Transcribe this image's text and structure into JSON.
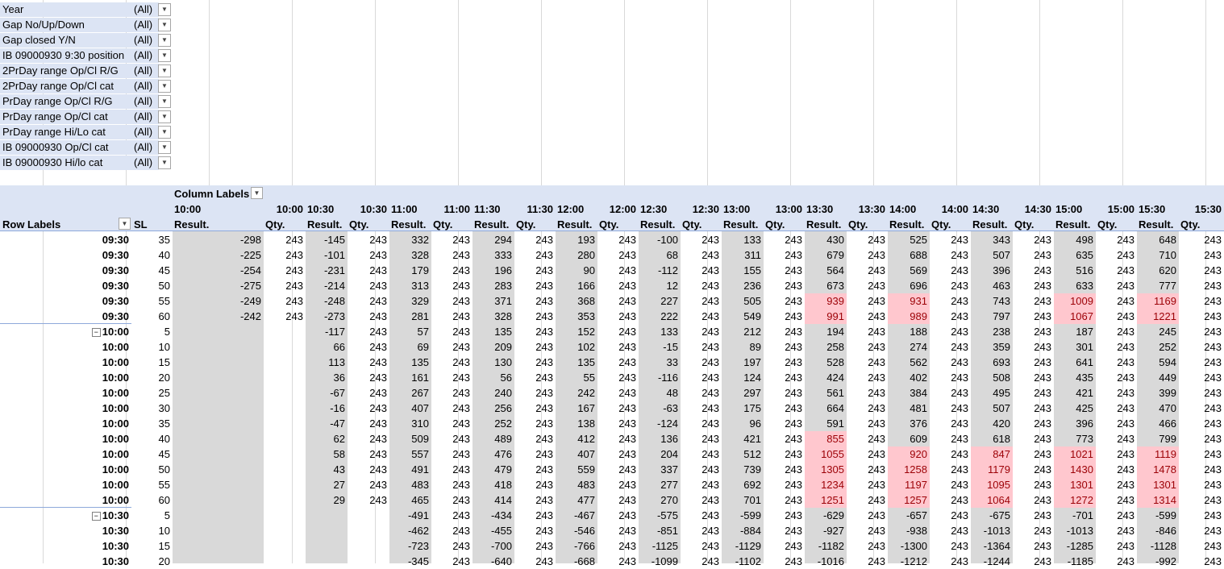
{
  "filters": [
    {
      "label": "Year",
      "value": "(All)"
    },
    {
      "label": "Gap No/Up/Down",
      "value": "(All)"
    },
    {
      "label": "Gap closed Y/N",
      "value": "(All)"
    },
    {
      "label": "IB 09000930 9:30 position",
      "value": "(All)"
    },
    {
      "label": "2PrDay range Op/Cl R/G",
      "value": "(All)"
    },
    {
      "label": "2PrDay range Op/Cl cat",
      "value": "(All)"
    },
    {
      "label": "PrDay range Op/Cl R/G",
      "value": "(All)"
    },
    {
      "label": "PrDay range Op/Cl cat",
      "value": "(All)"
    },
    {
      "label": "PrDay range Hi/Lo cat",
      "value": "(All)"
    },
    {
      "label": "IB 09000930 Op/Cl cat",
      "value": "(All)"
    },
    {
      "label": "IB 09000930 Hi/lo cat",
      "value": "(All)"
    }
  ],
  "pivot": {
    "column_labels_title": "Column Labels",
    "row_labels_title": "Row Labels",
    "sl_title": "SL",
    "column_headers": [
      {
        "time": "10:00",
        "measure": "Result."
      },
      {
        "time": "10:00",
        "measure": "Qty."
      },
      {
        "time": "10:30",
        "measure": "Result."
      },
      {
        "time": "10:30",
        "measure": "Qty."
      },
      {
        "time": "11:00",
        "measure": "Result."
      },
      {
        "time": "11:00",
        "measure": "Qty."
      },
      {
        "time": "11:30",
        "measure": "Result."
      },
      {
        "time": "11:30",
        "measure": "Qty."
      },
      {
        "time": "12:00",
        "measure": "Result."
      },
      {
        "time": "12:00",
        "measure": "Qty."
      },
      {
        "time": "12:30",
        "measure": "Result."
      },
      {
        "time": "12:30",
        "measure": "Qty."
      },
      {
        "time": "13:00",
        "measure": "Result."
      },
      {
        "time": "13:00",
        "measure": "Qty."
      },
      {
        "time": "13:30",
        "measure": "Result."
      },
      {
        "time": "13:30",
        "measure": "Qty."
      },
      {
        "time": "14:00",
        "measure": "Result."
      },
      {
        "time": "14:00",
        "measure": "Qty."
      },
      {
        "time": "14:30",
        "measure": "Result."
      },
      {
        "time": "14:30",
        "measure": "Qty."
      },
      {
        "time": "15:00",
        "measure": "Result."
      },
      {
        "time": "15:00",
        "measure": "Qty."
      },
      {
        "time": "15:30",
        "measure": "Result."
      },
      {
        "time": "15:30",
        "measure": "Qty."
      }
    ],
    "rows": [
      {
        "label": "09:30",
        "group": false,
        "sl": "35",
        "cells": [
          "-298",
          "243",
          "-145",
          "243",
          "332",
          "243",
          "294",
          "243",
          "193",
          "243",
          "-100",
          "243",
          "133",
          "243",
          "430",
          "243",
          "525",
          "243",
          "343",
          "243",
          "498",
          "243",
          "648",
          "243"
        ],
        "hl": []
      },
      {
        "label": "09:30",
        "group": false,
        "sl": "40",
        "cells": [
          "-225",
          "243",
          "-101",
          "243",
          "328",
          "243",
          "333",
          "243",
          "280",
          "243",
          "68",
          "243",
          "311",
          "243",
          "679",
          "243",
          "688",
          "243",
          "507",
          "243",
          "635",
          "243",
          "710",
          "243"
        ],
        "hl": []
      },
      {
        "label": "09:30",
        "group": false,
        "sl": "45",
        "cells": [
          "-254",
          "243",
          "-231",
          "243",
          "179",
          "243",
          "196",
          "243",
          "90",
          "243",
          "-112",
          "243",
          "155",
          "243",
          "564",
          "243",
          "569",
          "243",
          "396",
          "243",
          "516",
          "243",
          "620",
          "243"
        ],
        "hl": []
      },
      {
        "label": "09:30",
        "group": false,
        "sl": "50",
        "cells": [
          "-275",
          "243",
          "-214",
          "243",
          "313",
          "243",
          "283",
          "243",
          "166",
          "243",
          "12",
          "243",
          "236",
          "243",
          "673",
          "243",
          "696",
          "243",
          "463",
          "243",
          "633",
          "243",
          "777",
          "243"
        ],
        "hl": []
      },
      {
        "label": "09:30",
        "group": false,
        "sl": "55",
        "cells": [
          "-249",
          "243",
          "-248",
          "243",
          "329",
          "243",
          "371",
          "243",
          "368",
          "243",
          "227",
          "243",
          "505",
          "243",
          "939",
          "243",
          "931",
          "243",
          "743",
          "243",
          "1009",
          "243",
          "1169",
          "243"
        ],
        "hl": [
          14,
          16,
          20,
          22
        ]
      },
      {
        "label": "09:30",
        "group": false,
        "sl": "60",
        "cells": [
          "-242",
          "243",
          "-273",
          "243",
          "281",
          "243",
          "328",
          "243",
          "353",
          "243",
          "222",
          "243",
          "549",
          "243",
          "991",
          "243",
          "989",
          "243",
          "797",
          "243",
          "1067",
          "243",
          "1221",
          "243"
        ],
        "hl": [
          14,
          16,
          20,
          22
        ]
      },
      {
        "label": "10:00",
        "group": true,
        "sl": "5",
        "cells": [
          "",
          "",
          "-117",
          "243",
          "57",
          "243",
          "135",
          "243",
          "152",
          "243",
          "133",
          "243",
          "212",
          "243",
          "194",
          "243",
          "188",
          "243",
          "238",
          "243",
          "187",
          "243",
          "245",
          "243"
        ],
        "hl": []
      },
      {
        "label": "10:00",
        "group": false,
        "sl": "10",
        "cells": [
          "",
          "",
          "66",
          "243",
          "69",
          "243",
          "209",
          "243",
          "102",
          "243",
          "-15",
          "243",
          "89",
          "243",
          "258",
          "243",
          "274",
          "243",
          "359",
          "243",
          "301",
          "243",
          "252",
          "243"
        ],
        "hl": []
      },
      {
        "label": "10:00",
        "group": false,
        "sl": "15",
        "cells": [
          "",
          "",
          "113",
          "243",
          "135",
          "243",
          "130",
          "243",
          "135",
          "243",
          "33",
          "243",
          "197",
          "243",
          "528",
          "243",
          "562",
          "243",
          "693",
          "243",
          "641",
          "243",
          "594",
          "243"
        ],
        "hl": []
      },
      {
        "label": "10:00",
        "group": false,
        "sl": "20",
        "cells": [
          "",
          "",
          "36",
          "243",
          "161",
          "243",
          "56",
          "243",
          "55",
          "243",
          "-116",
          "243",
          "124",
          "243",
          "424",
          "243",
          "402",
          "243",
          "508",
          "243",
          "435",
          "243",
          "449",
          "243"
        ],
        "hl": []
      },
      {
        "label": "10:00",
        "group": false,
        "sl": "25",
        "cells": [
          "",
          "",
          "-67",
          "243",
          "267",
          "243",
          "240",
          "243",
          "242",
          "243",
          "48",
          "243",
          "297",
          "243",
          "561",
          "243",
          "384",
          "243",
          "495",
          "243",
          "421",
          "243",
          "399",
          "243"
        ],
        "hl": []
      },
      {
        "label": "10:00",
        "group": false,
        "sl": "30",
        "cells": [
          "",
          "",
          "-16",
          "243",
          "407",
          "243",
          "256",
          "243",
          "167",
          "243",
          "-63",
          "243",
          "175",
          "243",
          "664",
          "243",
          "481",
          "243",
          "507",
          "243",
          "425",
          "243",
          "470",
          "243"
        ],
        "hl": []
      },
      {
        "label": "10:00",
        "group": false,
        "sl": "35",
        "cells": [
          "",
          "",
          "-47",
          "243",
          "310",
          "243",
          "252",
          "243",
          "138",
          "243",
          "-124",
          "243",
          "96",
          "243",
          "591",
          "243",
          "376",
          "243",
          "420",
          "243",
          "396",
          "243",
          "466",
          "243"
        ],
        "hl": []
      },
      {
        "label": "10:00",
        "group": false,
        "sl": "40",
        "cells": [
          "",
          "",
          "62",
          "243",
          "509",
          "243",
          "489",
          "243",
          "412",
          "243",
          "136",
          "243",
          "421",
          "243",
          "855",
          "243",
          "609",
          "243",
          "618",
          "243",
          "773",
          "243",
          "799",
          "243"
        ],
        "hl": [
          14
        ]
      },
      {
        "label": "10:00",
        "group": false,
        "sl": "45",
        "cells": [
          "",
          "",
          "58",
          "243",
          "557",
          "243",
          "476",
          "243",
          "407",
          "243",
          "204",
          "243",
          "512",
          "243",
          "1055",
          "243",
          "920",
          "243",
          "847",
          "243",
          "1021",
          "243",
          "1119",
          "243"
        ],
        "hl": [
          14,
          16,
          18,
          20,
          22
        ]
      },
      {
        "label": "10:00",
        "group": false,
        "sl": "50",
        "cells": [
          "",
          "",
          "43",
          "243",
          "491",
          "243",
          "479",
          "243",
          "559",
          "243",
          "337",
          "243",
          "739",
          "243",
          "1305",
          "243",
          "1258",
          "243",
          "1179",
          "243",
          "1430",
          "243",
          "1478",
          "243"
        ],
        "hl": [
          14,
          16,
          18,
          20,
          22
        ]
      },
      {
        "label": "10:00",
        "group": false,
        "sl": "55",
        "cells": [
          "",
          "",
          "27",
          "243",
          "483",
          "243",
          "418",
          "243",
          "483",
          "243",
          "277",
          "243",
          "692",
          "243",
          "1234",
          "243",
          "1197",
          "243",
          "1095",
          "243",
          "1301",
          "243",
          "1301",
          "243"
        ],
        "hl": [
          14,
          16,
          18,
          20,
          22
        ]
      },
      {
        "label": "10:00",
        "group": false,
        "sl": "60",
        "cells": [
          "",
          "",
          "29",
          "243",
          "465",
          "243",
          "414",
          "243",
          "477",
          "243",
          "270",
          "243",
          "701",
          "243",
          "1251",
          "243",
          "1257",
          "243",
          "1064",
          "243",
          "1272",
          "243",
          "1314",
          "243"
        ],
        "hl": [
          14,
          16,
          18,
          20,
          22
        ]
      },
      {
        "label": "10:30",
        "group": true,
        "sl": "5",
        "cells": [
          "",
          "",
          "",
          "",
          "-491",
          "243",
          "-434",
          "243",
          "-467",
          "243",
          "-575",
          "243",
          "-599",
          "243",
          "-629",
          "243",
          "-657",
          "243",
          "-675",
          "243",
          "-701",
          "243",
          "-599",
          "243"
        ],
        "hl": []
      },
      {
        "label": "10:30",
        "group": false,
        "sl": "10",
        "cells": [
          "",
          "",
          "",
          "",
          "-462",
          "243",
          "-455",
          "243",
          "-546",
          "243",
          "-851",
          "243",
          "-884",
          "243",
          "-927",
          "243",
          "-938",
          "243",
          "-1013",
          "243",
          "-1013",
          "243",
          "-846",
          "243"
        ],
        "hl": []
      },
      {
        "label": "10:30",
        "group": false,
        "sl": "15",
        "cells": [
          "",
          "",
          "",
          "",
          "-723",
          "243",
          "-700",
          "243",
          "-766",
          "243",
          "-1125",
          "243",
          "-1129",
          "243",
          "-1182",
          "243",
          "-1300",
          "243",
          "-1364",
          "243",
          "-1285",
          "243",
          "-1128",
          "243"
        ],
        "hl": []
      },
      {
        "label": "10:30",
        "group": false,
        "sl": "20",
        "cells": [
          "",
          "",
          "",
          "",
          "-345",
          "243",
          "-640",
          "243",
          "-668",
          "243",
          "-1099",
          "243",
          "-1102",
          "243",
          "-1016",
          "243",
          "-1212",
          "243",
          "-1244",
          "243",
          "-1185",
          "243",
          "-992",
          "243"
        ],
        "hl": []
      }
    ]
  }
}
